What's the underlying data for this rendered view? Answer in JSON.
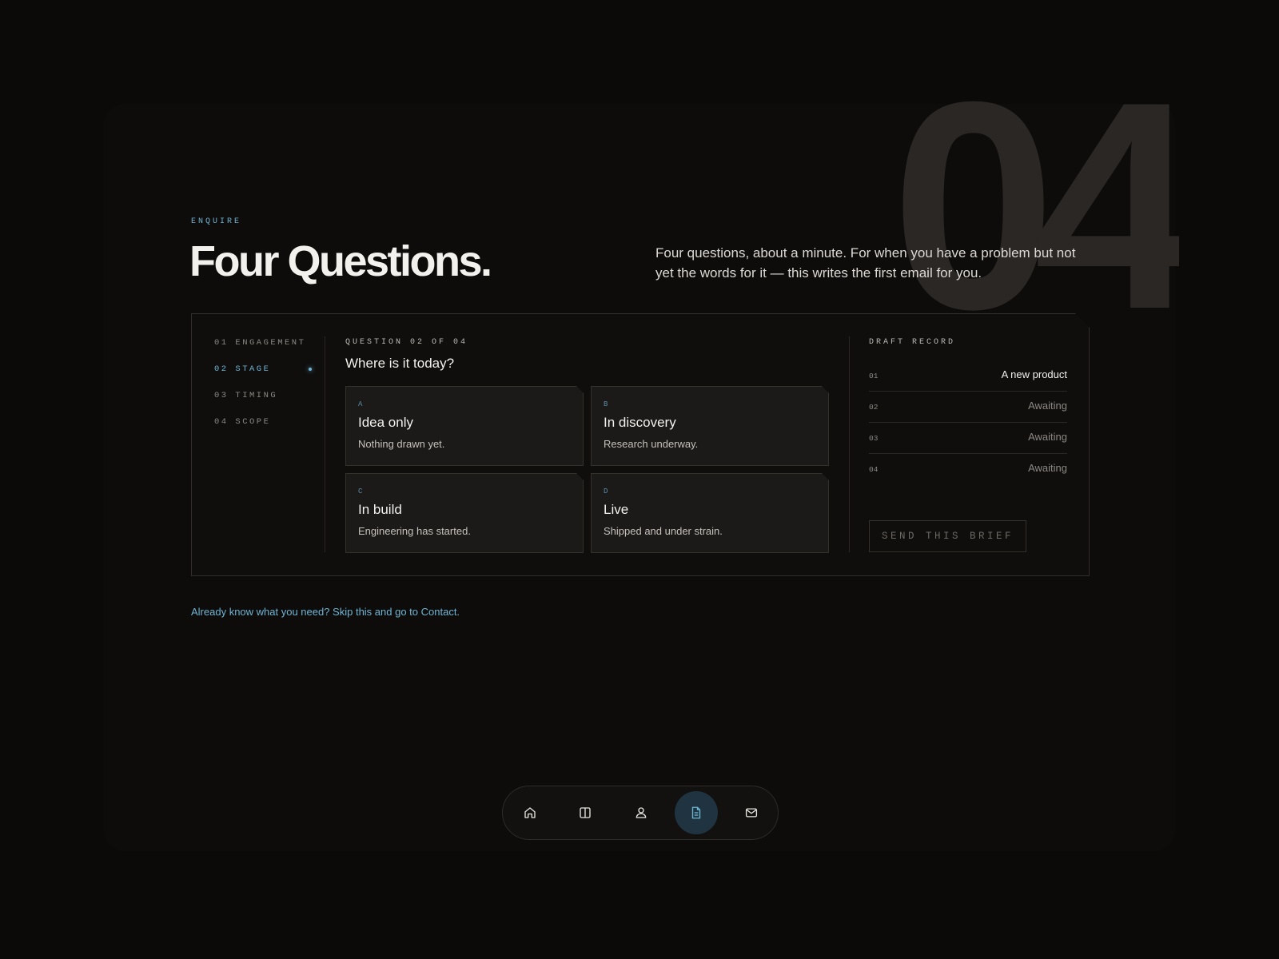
{
  "bignum": "04",
  "header": {
    "eyebrow": "ENQUIRE",
    "title": "Four Questions.",
    "intro": "Four questions, about a minute. For when you have a problem but not yet the words for it — this writes the first email for you."
  },
  "steps": [
    {
      "label": "01 ENGAGEMENT"
    },
    {
      "label": "02 STAGE"
    },
    {
      "label": "03 TIMING"
    },
    {
      "label": "04 SCOPE"
    }
  ],
  "question": {
    "meta": "QUESTION 02 OF 04",
    "text": "Where is it today?",
    "options": [
      {
        "key": "A",
        "title": "Idea only",
        "desc": "Nothing drawn yet."
      },
      {
        "key": "B",
        "title": "In discovery",
        "desc": "Research underway."
      },
      {
        "key": "C",
        "title": "In build",
        "desc": "Engineering has started."
      },
      {
        "key": "D",
        "title": "Live",
        "desc": "Shipped and under strain."
      }
    ]
  },
  "record": {
    "title": "DRAFT RECORD",
    "rows": [
      {
        "num": "01",
        "value": "A new product"
      },
      {
        "num": "02",
        "value": "Awaiting"
      },
      {
        "num": "03",
        "value": "Awaiting"
      },
      {
        "num": "04",
        "value": "Awaiting"
      }
    ],
    "send_label": "SEND THIS BRIEF"
  },
  "skip_link": "Already know what you need? Skip this and go to Contact.",
  "dock": {
    "items": [
      {
        "icon": "home-icon"
      },
      {
        "icon": "columns-icon"
      },
      {
        "icon": "user-icon"
      },
      {
        "icon": "document-icon",
        "active": true
      },
      {
        "icon": "mail-icon"
      }
    ]
  },
  "colors": {
    "accent": "#6fb4d3",
    "background": "#0b0a09",
    "card": "#1b1a18"
  }
}
